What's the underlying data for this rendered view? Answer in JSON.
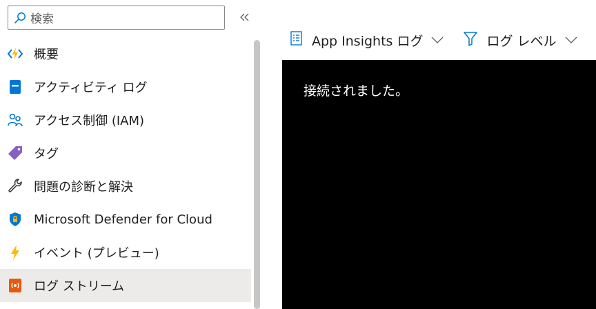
{
  "search": {
    "placeholder": "検索"
  },
  "sidebar": {
    "items": [
      {
        "label": "概要",
        "icon": "quickstart-lightning-icon",
        "selected": false
      },
      {
        "label": "アクティビティ ログ",
        "icon": "activity-log-icon",
        "selected": false
      },
      {
        "label": "アクセス制御 (IAM)",
        "icon": "people-icon",
        "selected": false
      },
      {
        "label": "タグ",
        "icon": "tag-icon",
        "selected": false
      },
      {
        "label": "問題の診断と解決",
        "icon": "wrench-icon",
        "selected": false
      },
      {
        "label": "Microsoft Defender for Cloud",
        "icon": "shield-icon",
        "selected": false
      },
      {
        "label": "イベント (プレビュー)",
        "icon": "lightning-icon",
        "selected": false
      },
      {
        "label": "ログ ストリーム",
        "icon": "log-stream-icon",
        "selected": true
      }
    ]
  },
  "toolbar": {
    "source_label": "App Insights ログ",
    "level_label": "ログ レベル"
  },
  "console": {
    "lines": [
      "接続されました。"
    ]
  },
  "colors": {
    "accent": "#0078d4",
    "console_bg": "#000000",
    "console_text": "#ffffff",
    "selected_bg": "#edebe9"
  }
}
